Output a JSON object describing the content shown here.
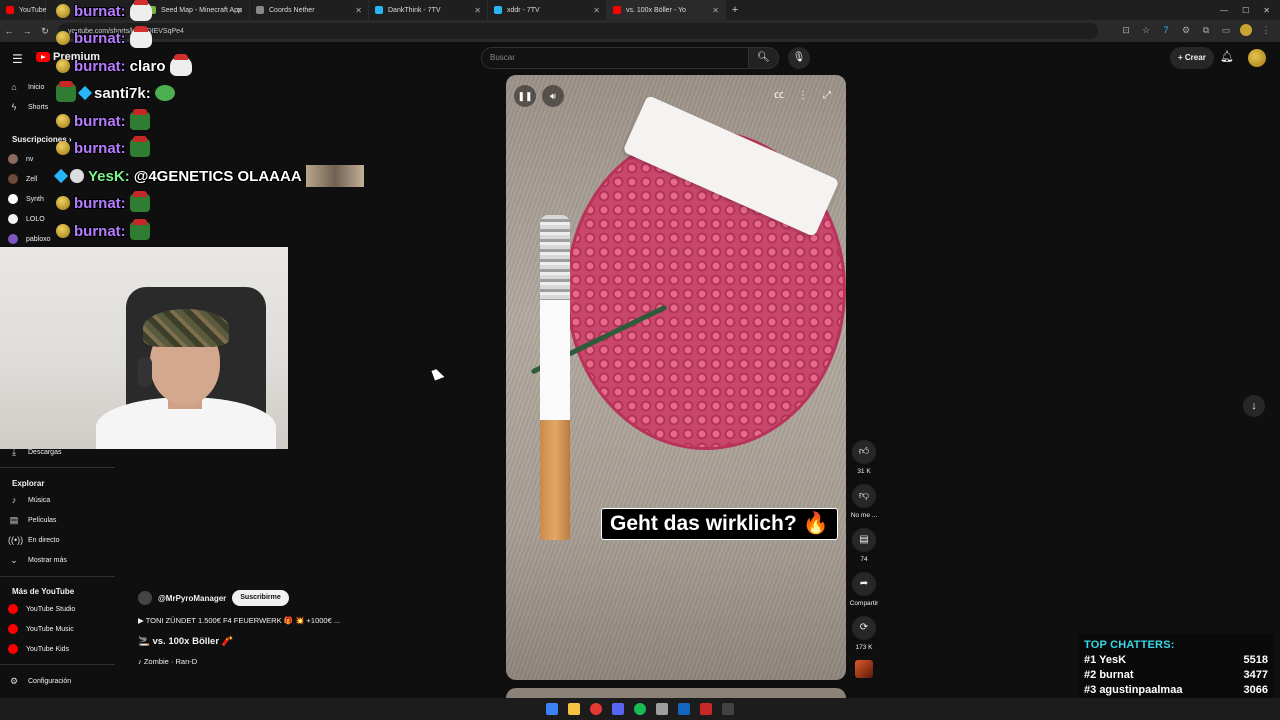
{
  "browser": {
    "tabs": [
      {
        "title": "YouTube"
      },
      {
        "title": "Seed Map - Minecraft App"
      },
      {
        "title": "Coords Nether"
      },
      {
        "title": "DankThink - 7TV"
      },
      {
        "title": "xddr - 7TV"
      },
      {
        "title": "vs. 100x Böller - Yo"
      }
    ],
    "url": "youtube.com/shorts/k8xSDIEVSqPe4"
  },
  "youtube": {
    "logo_text": "Premium",
    "search_placeholder": "Buscar",
    "create_label": "Crear"
  },
  "sidebar": {
    "top": [
      {
        "label": "Inicio",
        "icon": "home-icon"
      },
      {
        "label": "Shorts",
        "icon": "shorts-icon"
      }
    ],
    "subs_heading": "Suscripciones",
    "subs": [
      {
        "label": "nv",
        "color": "#8a6b5c"
      },
      {
        "label": "Zell",
        "color": "#6a4a3a"
      },
      {
        "label": "Synth",
        "color": "#ffffff"
      },
      {
        "label": "LOLO",
        "color": "#f1f1f1"
      },
      {
        "label": "pabloxo",
        "color": "#7e57c2"
      }
    ],
    "downloads": "Descargas",
    "explore_heading": "Explorar",
    "explore": [
      {
        "label": "Música",
        "icon": "music-icon"
      },
      {
        "label": "Películas",
        "icon": "film-icon"
      },
      {
        "label": "En directo",
        "icon": "live-icon"
      },
      {
        "label": "Mostrar más",
        "icon": "chevron-down-icon"
      }
    ],
    "more_heading": "Más de YouTube",
    "more": [
      {
        "label": "YouTube Studio"
      },
      {
        "label": "YouTube Music"
      },
      {
        "label": "YouTube Kids"
      }
    ],
    "settings": "Configuración"
  },
  "chat": [
    {
      "user": "burnat:",
      "msg": ""
    },
    {
      "user": "burnat:",
      "msg": ""
    },
    {
      "user": "burnat:",
      "msg": "claro"
    },
    {
      "user": "santi7k:",
      "msg": ""
    },
    {
      "user": "burnat:",
      "msg": ""
    },
    {
      "user": "burnat:",
      "msg": ""
    },
    {
      "user": "YesK:",
      "msg": "@4GENETICS OLAAAA"
    },
    {
      "user": "burnat:",
      "msg": ""
    },
    {
      "user": "burnat:",
      "msg": ""
    }
  ],
  "video": {
    "caption": "Geht das wirklich? 🔥",
    "actions": [
      {
        "label": "31 K",
        "icon": "like-icon"
      },
      {
        "label": "No me ...",
        "icon": "dislike-icon"
      },
      {
        "label": "74",
        "icon": "comment-icon"
      },
      {
        "label": "Compartir",
        "icon": "share-icon"
      },
      {
        "label": "173 K",
        "icon": "remix-icon"
      }
    ],
    "channel": "@MrPyroManager",
    "subscribe_label": "Suscribirme",
    "description": "▶ TONI ZÜNDET 1.500€ F4 FEUERWERK 🎁 💥 +1000€ ...",
    "title": "🚬 vs. 100x Böller 🧨",
    "music": "♪ Zombie · Ran-D"
  },
  "top_chatters": {
    "title": "TOP CHATTERS:",
    "rows": [
      {
        "rank": "#1",
        "name": "YesK",
        "count": "5518"
      },
      {
        "rank": "#2",
        "name": "burnat",
        "count": "3477"
      },
      {
        "rank": "#3",
        "name": "agustinpaalmaa",
        "count": "3066"
      }
    ]
  }
}
